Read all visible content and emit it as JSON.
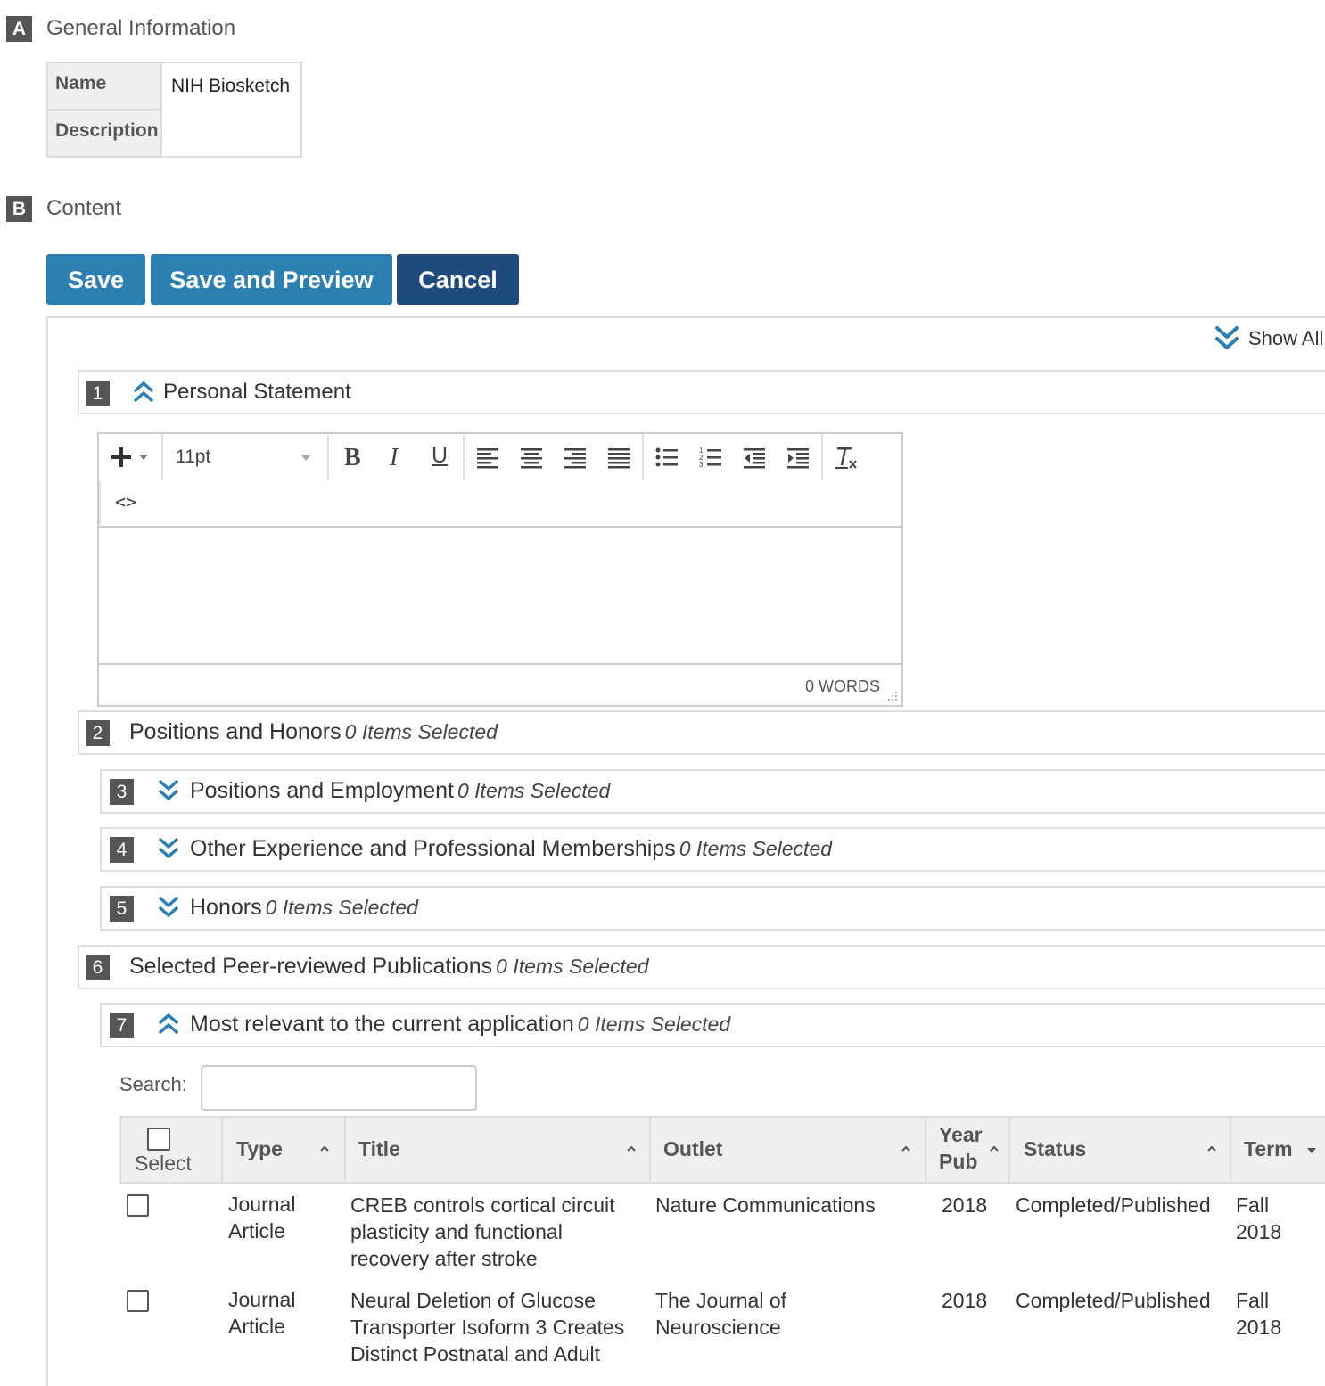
{
  "section_a": {
    "letter": "A",
    "title": "General Information"
  },
  "general_info": {
    "name_label": "Name",
    "name_value": "NIH Biosketch",
    "description_label": "Description",
    "description_value": ""
  },
  "section_b": {
    "letter": "B",
    "title": "Content"
  },
  "buttons": {
    "save": "Save",
    "save_preview": "Save and Preview",
    "cancel": "Cancel"
  },
  "show_all": "Show All",
  "sections": [
    {
      "num": "1",
      "title": "Personal Statement",
      "count": ""
    },
    {
      "num": "2",
      "title": "Positions and Honors",
      "count": "0 Items Selected"
    },
    {
      "num": "3",
      "title": "Positions and Employment",
      "count": "0 Items Selected"
    },
    {
      "num": "4",
      "title": "Other Experience and Professional Memberships",
      "count": "0 Items Selected"
    },
    {
      "num": "5",
      "title": "Honors",
      "count": "0 Items Selected"
    },
    {
      "num": "6",
      "title": "Selected Peer-reviewed Publications",
      "count": "0 Items Selected"
    },
    {
      "num": "7",
      "title": "Most relevant to the current application",
      "count": "0 Items Selected"
    }
  ],
  "editor": {
    "font_size": "11pt",
    "word_count": "0 WORDS",
    "source_icon": "<>"
  },
  "search": {
    "label": "Search:",
    "value": ""
  },
  "table": {
    "columns": {
      "select": "Select",
      "type": "Type",
      "title": "Title",
      "outlet": "Outlet",
      "year_pub_1": "Year",
      "year_pub_2": "Pub",
      "status": "Status",
      "term": "Term"
    },
    "rows": [
      {
        "type": [
          "Journal",
          "Article"
        ],
        "title": [
          "CREB controls cortical circuit",
          "plasticity and functional",
          "recovery after stroke"
        ],
        "outlet": [
          "Nature Communications"
        ],
        "year": "2018",
        "status": "Completed/Published",
        "term": [
          "Fall",
          "2018"
        ]
      },
      {
        "type": [
          "Journal",
          "Article"
        ],
        "title": [
          "Neural Deletion of Glucose",
          "Transporter Isoform 3 Creates",
          "Distinct Postnatal and Adult"
        ],
        "outlet": [
          "The Journal of",
          "Neuroscience"
        ],
        "year": "2018",
        "status": "Completed/Published",
        "term": [
          "Fall",
          "2018"
        ]
      }
    ]
  },
  "colors": {
    "primary": "#2b7fb1",
    "dark_primary": "#1f4a7c",
    "label_box": "#555555",
    "chevron": "#2b7fb1"
  }
}
